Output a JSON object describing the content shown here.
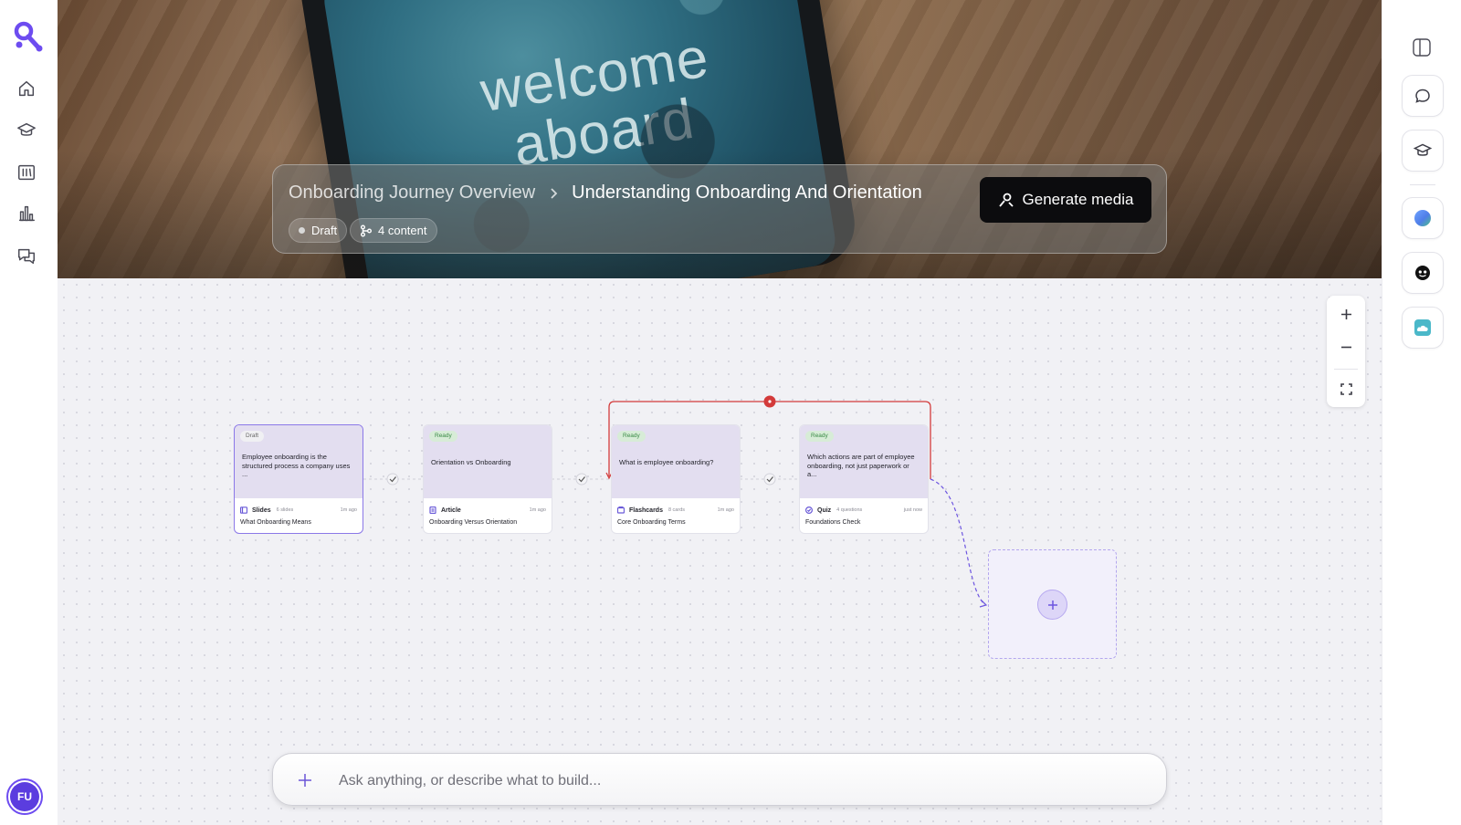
{
  "hero": {
    "phone_text": "welcome aboard",
    "breadcrumb_parent": "Onboarding Journey Overview",
    "breadcrumb_current": "Understanding Onboarding And Orientation",
    "status_label": "Draft",
    "content_count_label": "4 content",
    "generate_button_label": "Generate media"
  },
  "nodes": [
    {
      "status": "Draft",
      "question": "Employee onboarding is the structured process a company uses ...",
      "type": "Slides",
      "count": "6 slides",
      "time": "1m ago",
      "title": "What Onboarding Means"
    },
    {
      "status": "Ready",
      "question": "Orientation vs Onboarding",
      "type": "Article",
      "count": "",
      "time": "1m ago",
      "title": "Onboarding Versus Orientation"
    },
    {
      "status": "Ready",
      "question": "What is employee onboarding?",
      "type": "Flashcards",
      "count": "8 cards",
      "time": "1m ago",
      "title": "Core Onboarding Terms"
    },
    {
      "status": "Ready",
      "question": "Which actions are part of employee onboarding, not just paperwork or a...",
      "type": "Quiz",
      "count": "4 questions",
      "time": "just now",
      "title": "Foundations Check"
    }
  ],
  "prompt": {
    "placeholder": "Ask anything, or describe what to build..."
  },
  "user": {
    "initials": "FU"
  },
  "colors": {
    "accent": "#6d4cf0",
    "loop_edge": "#d33a3a",
    "ready_badge": "#3a8a46"
  }
}
